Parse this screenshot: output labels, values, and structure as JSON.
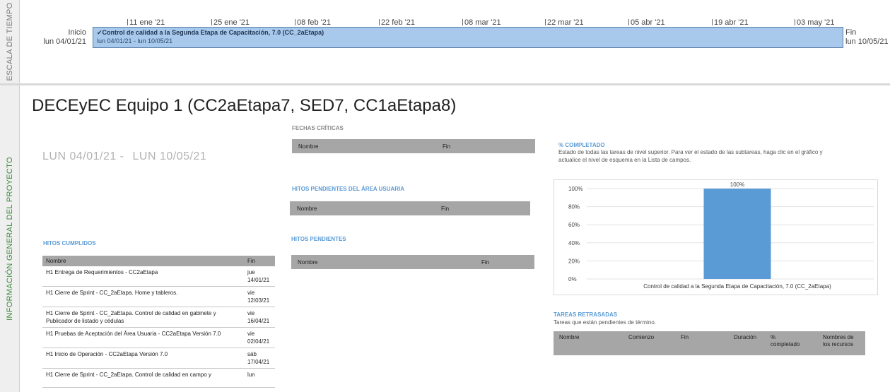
{
  "rails": {
    "timescale": "ESCALA DE TIEMPO",
    "overview": "INFORMACIÓN GENERAL DEL PROYECTO"
  },
  "timeline": {
    "ticks": [
      "11 ene '21",
      "25 ene '21",
      "08 feb '21",
      "22 feb '21",
      "08 mar '21",
      "22 mar '21",
      "05 abr '21",
      "19 abr '21",
      "03 may '21"
    ],
    "start_label": "Inicio",
    "start_date": "lun 04/01/21",
    "end_label": "Fin",
    "end_date": "lun 10/05/21",
    "bar_check": "✔",
    "bar_title": "Control de calidad a la Segunda Etapa de Capacitación, 7.0 (CC_2aEtapa)",
    "bar_dates": "lun 04/01/21 - lun 10/05/21"
  },
  "project": {
    "title": "DECEyEC Equipo 1 (CC2aEtapa7, SED7, CC1aEtapa8)",
    "start": "LUN 04/01/21 -",
    "end": "LUN 10/05/21"
  },
  "fechas_criticas": {
    "heading": "FECHAS CRÍTICAS",
    "col_name": "Nombre",
    "col_end": "Fin"
  },
  "hitos_area_usuaria": {
    "heading": "HITOS PENDIENTES DEL ÁREA USUARIA",
    "col_name": "Nombre",
    "col_end": "Fin"
  },
  "hitos_pendientes": {
    "heading": "HITOS PENDIENTES",
    "col_name": "Nombre",
    "col_end": "Fin"
  },
  "hitos_cumplidos": {
    "heading": "HITOS CUMPLIDOS",
    "col_name": "Nombre",
    "col_end": "Fin",
    "rows": [
      {
        "name": "H1 Entrega de Requerimientos - CC2aEtapa",
        "end": "jue 14/01/21"
      },
      {
        "name": "H1 Cierre de Sprint - CC_2aEtapa. Home y tableros.",
        "end": "vie 12/03/21"
      },
      {
        "name": "H1 Cierre de Sprint - CC_2aEtapa. Control de calidad en gabinete y Publicador de listado y cédulas",
        "end": "vie 16/04/21"
      },
      {
        "name": "H1 Pruebas de Aceptación del Área Usuaria - CC2aEtapa Versión 7.0",
        "end": "vie 02/04/21"
      },
      {
        "name": "H1 Inicio de Operación - CC2aEtapa Versión 7.0",
        "end": "sáb 17/04/21"
      },
      {
        "name": "H1 Cierre de Sprint - CC_2aEtapa. Control de calidad en campo y",
        "end": "lun"
      }
    ]
  },
  "completado": {
    "heading": "% COMPLETADO",
    "note": "Estado de todas las tareas de nivel superior. Para ver el estado de las subtareas, haga clic en el gráfico y actualice el nivel de esquema en la Lista de campos."
  },
  "tareas_retrasadas": {
    "heading": "TAREAS RETRASADAS",
    "note": "Tareas que están pendientes de término.",
    "columns": [
      "Nombre",
      "Comienzo",
      "Fin",
      "Duración",
      "% completado",
      "Nombres de los recursos"
    ]
  },
  "colors": {
    "bar_fill": "#5b9bd5",
    "accent_heading": "#5b9bd5",
    "rail_overview_text": "#3b8a3b",
    "table_header": "#a6a6a6"
  },
  "chart_data": {
    "type": "bar",
    "categories": [
      "Control de calidad a la Segunda Etapa de Capacitación, 7.0 (CC_2aEtapa)"
    ],
    "values": [
      100
    ],
    "data_labels": [
      "100%"
    ],
    "yticks": [
      "0%",
      "20%",
      "40%",
      "60%",
      "80%",
      "100%"
    ],
    "ylim": [
      0,
      100
    ],
    "grid": true,
    "legend": "none"
  }
}
